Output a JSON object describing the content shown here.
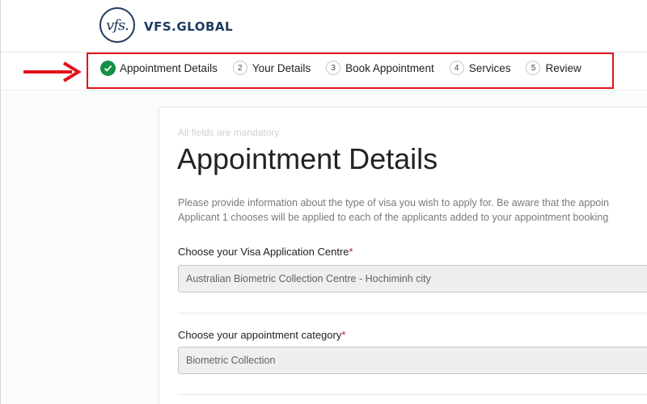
{
  "header": {
    "logo_mark": "vfs.",
    "logo_text": "VFS.GLOBAL"
  },
  "stepper": {
    "steps": [
      {
        "number": "",
        "label": "Appointment Details",
        "status": "completed"
      },
      {
        "number": "2",
        "label": "Your Details",
        "status": "pending"
      },
      {
        "number": "3",
        "label": "Book Appointment",
        "status": "pending"
      },
      {
        "number": "4",
        "label": "Services",
        "status": "pending"
      },
      {
        "number": "5",
        "label": "Review",
        "status": "pending"
      }
    ]
  },
  "form": {
    "mandatory_note": "All fields are mandatory",
    "title": "Appointment Details",
    "intro_line1": "Please provide information about the type of visa you wish to apply for. Be aware that the appoin",
    "intro_line2": "Applicant 1 chooses will be applied to each of the applicants added to your appointment booking",
    "centre_label": "Choose your Visa Application Centre",
    "centre_value": "Australian Biometric Collection Centre - Hochiminh city",
    "category_label": "Choose your appointment category",
    "category_value": "Biometric Collection",
    "required_marker": "*"
  },
  "colors": {
    "brand": "#1f3a60",
    "success": "#168f48",
    "highlight": "#e0141b",
    "required": "#c8102e"
  },
  "icons": {
    "completed_step": "check-circle-icon",
    "annotation": "arrow-right-icon"
  }
}
